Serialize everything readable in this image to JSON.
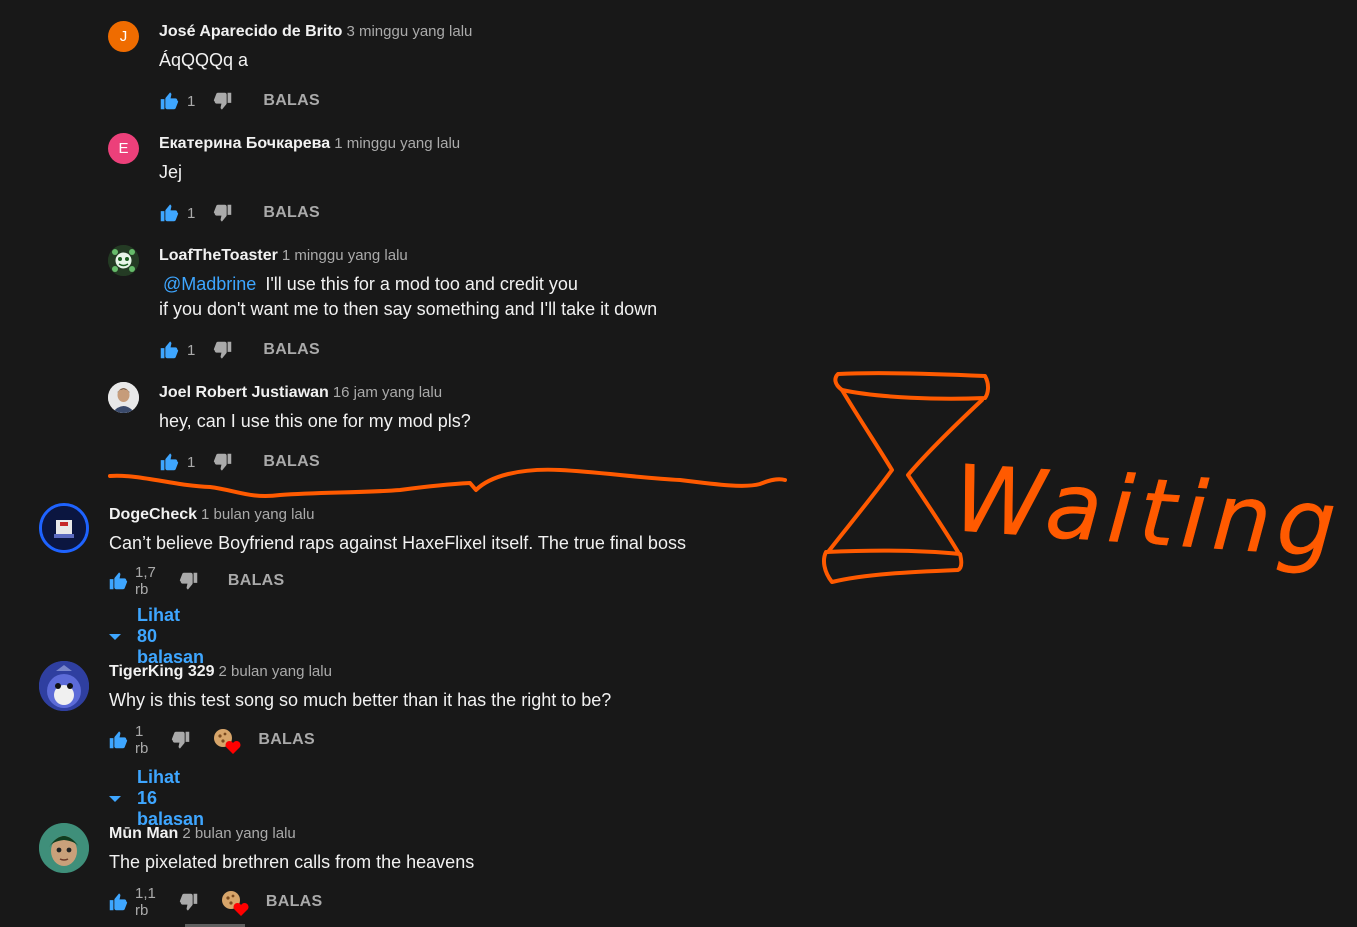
{
  "colors": {
    "background": "#181818",
    "like_blue": "#3ea6ff",
    "annotation_orange": "#ff5a00"
  },
  "reply_label": "BALAS",
  "replies": [
    {
      "avatar_letter": "J",
      "avatar_color": "#ef6c00",
      "author": "José Aparecido de Brito",
      "time": "3 minggu yang lalu",
      "text": "ÁqQQQq a",
      "likes": "1"
    },
    {
      "avatar_letter": "E",
      "avatar_color": "#ec407a",
      "author": "Екатерина Бочкарева",
      "time": "1 minggu yang lalu",
      "text": "Jej",
      "likes": "1"
    },
    {
      "avatar_icon": "flower-avatar-icon",
      "author": "LoafTheToaster",
      "time": "1 minggu yang lalu",
      "mention": "@Madbrine",
      "text_line1": "I'll use this for a mod too and credit you",
      "text_line2": "if you don't want me to then say something and I'll take it down",
      "likes": "1"
    },
    {
      "avatar_icon": "person-photo-avatar-icon",
      "author": "Joel Robert Justiawan",
      "time": "16 jam yang lalu",
      "text": "hey, can I use this one for my mod pls?",
      "likes": "1"
    }
  ],
  "comments": [
    {
      "avatar_icon": "doge-check-avatar-icon",
      "author": "DogeCheck",
      "time": "1 bulan yang lalu",
      "text": "Can’t believe Boyfriend raps against HaxeFlixel itself. The true final boss",
      "likes": "1,7 rb",
      "view_replies": "Lihat 80 balasan"
    },
    {
      "avatar_icon": "blue-character-avatar-icon",
      "author": "TigerKing 329",
      "time": "2 bulan yang lalu",
      "text": "Why is this test song so much better than it has the right to be?",
      "likes": "1 rb",
      "creator_heart": true,
      "view_replies": "Lihat 16 balasan"
    },
    {
      "avatar_icon": "green-hair-character-avatar-icon",
      "author": "Mūn Man",
      "time": "2 bulan yang lalu",
      "text": "The pixelated brethren calls from the heavens",
      "likes": "1,1 rb",
      "creator_heart": true
    }
  ],
  "annotation": {
    "text": "Waiting",
    "icon": "hourglass-drawing-icon"
  }
}
